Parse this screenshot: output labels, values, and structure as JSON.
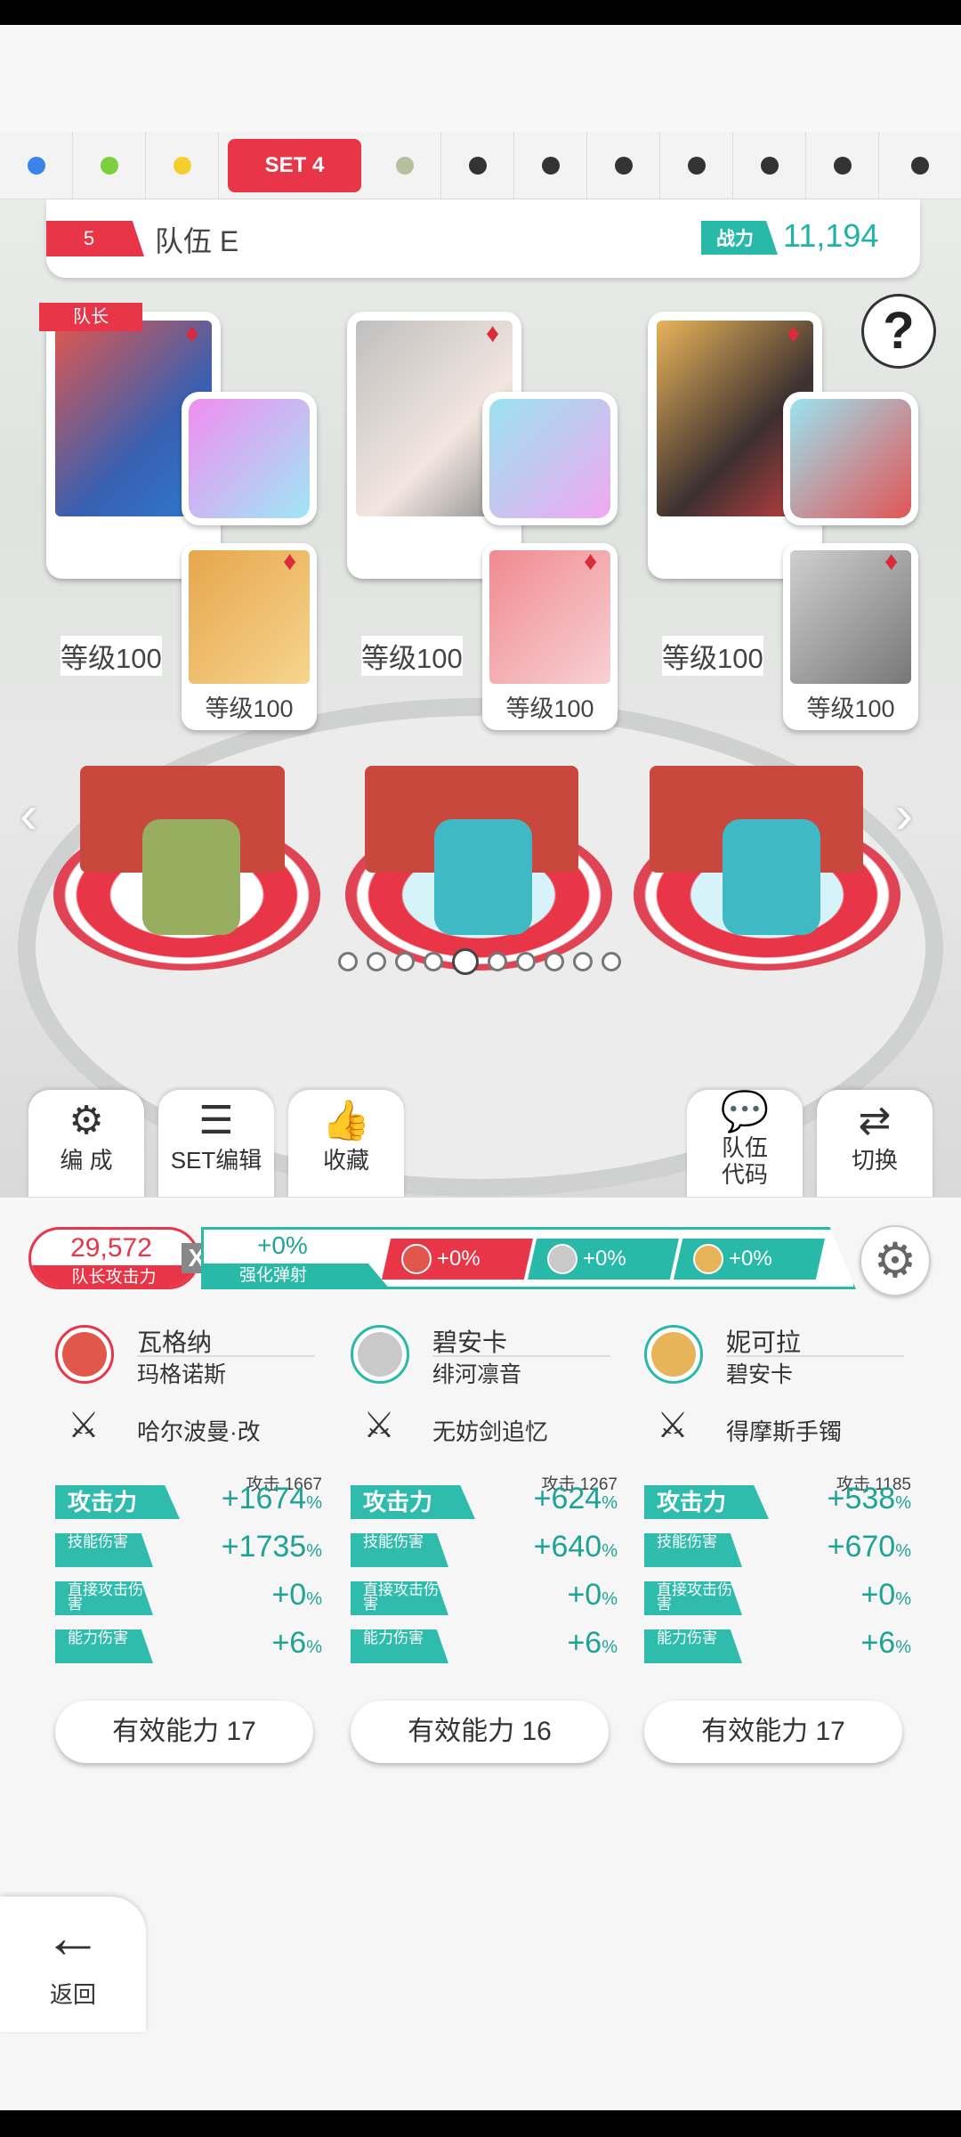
{
  "set_tabs": {
    "dots": [
      "#3a83e8",
      "#7ccf3d",
      "#f3cf2c",
      "",
      "#b8bf9c",
      "#333333",
      "#333333",
      "#333333",
      "#333333",
      "#333333",
      "#333333",
      "#333333"
    ],
    "active_label": "SET 4"
  },
  "team": {
    "number": "5",
    "name": "队伍 E",
    "power_label": "战力",
    "power_value": "11,194"
  },
  "help_icon": "?",
  "leader_badge": "队长",
  "suit_icon": "♦",
  "slots": [
    {
      "main_level": "等级100",
      "sub_level": "等级100",
      "main_color": "#e2574c",
      "sub_color": "#e6a64c",
      "weapon_color": "#f08ef0"
    },
    {
      "main_level": "等级100",
      "sub_level": "等级100",
      "main_color": "#c9c9c9",
      "sub_color": "#f08a8f",
      "weapon_color": "#9be3f0"
    },
    {
      "main_level": "等级100",
      "sub_level": "等级100",
      "main_color": "#e8b45a",
      "sub_color": "#cfcfcf",
      "weapon_color": "#9be3f0"
    }
  ],
  "action_buttons": {
    "formation": "编 成",
    "set_edit": "SET编辑",
    "favorites": "收藏",
    "team_code_1": "队伍",
    "team_code_2": "代码",
    "switch": "切换"
  },
  "attack_summary": {
    "value": "29,572",
    "label": "队长攻击力",
    "x": "X",
    "multiplier": "+0%",
    "multiplier_label": "强化弹射",
    "chips": [
      "+0%",
      "+0%",
      "+0%"
    ]
  },
  "heroes": [
    {
      "name": "瓦格纳",
      "partner": "玛格诺斯",
      "weapon": "哈尔波曼·改",
      "attack_base": "攻击 1667",
      "stats": [
        {
          "label": "攻击力",
          "value": "+1674",
          "unit": "%"
        },
        {
          "label": "技能伤害",
          "value": "+1735",
          "unit": "%"
        },
        {
          "label": "直接攻击伤害",
          "value": "+0",
          "unit": "%"
        },
        {
          "label": "能力伤害",
          "value": "+6",
          "unit": "%"
        }
      ],
      "effective": "有效能力 17"
    },
    {
      "name": "碧安卡",
      "partner": "绯河凛音",
      "weapon": "无妨剑追忆",
      "attack_base": "攻击 1267",
      "stats": [
        {
          "label": "攻击力",
          "value": "+624",
          "unit": "%"
        },
        {
          "label": "技能伤害",
          "value": "+640",
          "unit": "%"
        },
        {
          "label": "直接攻击伤害",
          "value": "+0",
          "unit": "%"
        },
        {
          "label": "能力伤害",
          "value": "+6",
          "unit": "%"
        }
      ],
      "effective": "有效能力 16"
    },
    {
      "name": "妮可拉",
      "partner": "碧安卡",
      "weapon": "得摩斯手镯",
      "attack_base": "攻击 1185",
      "stats": [
        {
          "label": "攻击力",
          "value": "+538",
          "unit": "%"
        },
        {
          "label": "技能伤害",
          "value": "+670",
          "unit": "%"
        },
        {
          "label": "直接攻击伤害",
          "value": "+0",
          "unit": "%"
        },
        {
          "label": "能力伤害",
          "value": "+6",
          "unit": "%"
        }
      ],
      "effective": "有效能力 17"
    }
  ],
  "back": {
    "icon": "←",
    "label": "返回"
  }
}
